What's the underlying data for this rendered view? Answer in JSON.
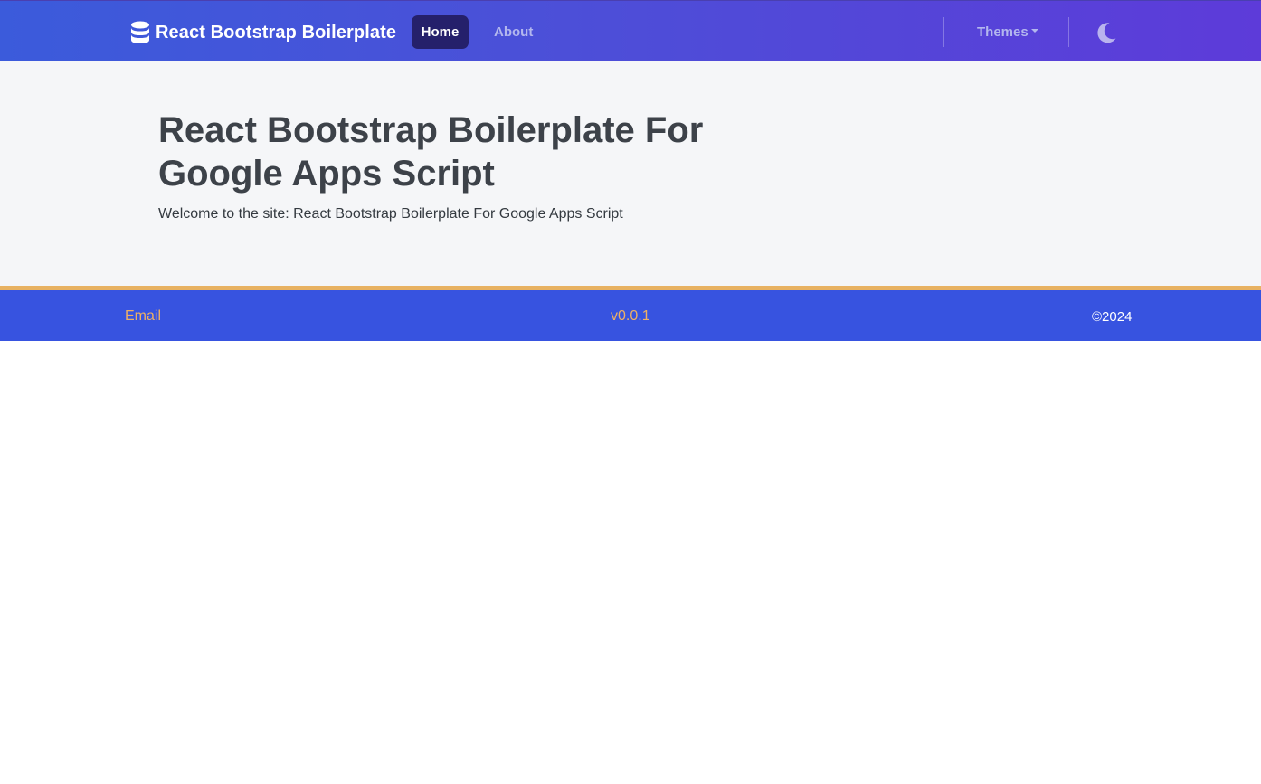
{
  "navbar": {
    "brand": {
      "icon": "database-icon",
      "label": "React Bootstrap Boilerplate"
    },
    "links": [
      {
        "label": "Home",
        "active": true
      },
      {
        "label": "About",
        "active": false
      }
    ],
    "themes_label": "Themes",
    "theme_toggle_icon": "moon-icon"
  },
  "hero": {
    "title": "React Bootstrap Boilerplate For Google Apps Script",
    "subtitle": "Welcome to the site: React Bootstrap Boilerplate For Google Apps Script"
  },
  "footer": {
    "email_label": "Email",
    "version": "v0.0.1",
    "copyright": "©2024"
  },
  "colors": {
    "navbar_gradient_start": "#3b5bdb",
    "navbar_gradient_end": "#5d3bd9",
    "active_nav_bg": "#25206b",
    "hero_bg": "#f5f6f8",
    "footer_bg": "#3753e0",
    "footer_accent": "#e8b262",
    "footer_link": "#eeb065"
  }
}
